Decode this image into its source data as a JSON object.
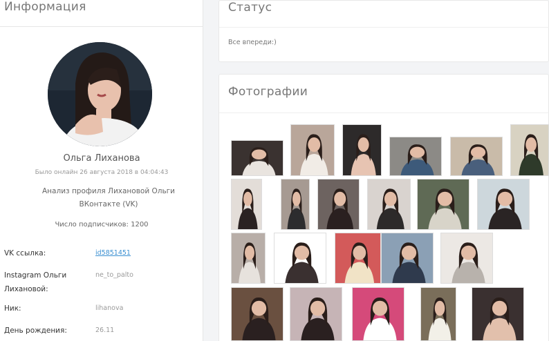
{
  "info_panel": {
    "title": "Информация",
    "name": "Ольга Лиханова",
    "last_seen": "Было онлайн 26 августа 2018 в 04:04:43",
    "analysis": "Анализ профиля Лихановой Ольги ВКонтакте (VK)",
    "subscribers": "Число подписчиков: 1200",
    "rows": [
      {
        "label": "VK ссылка:",
        "value": "id5851451"
      },
      {
        "label": "Instagram Ольги Лихановой:",
        "value": "ne_to_palto"
      },
      {
        "label": "Ник:",
        "value": "lihanova"
      },
      {
        "label": "День рождения:",
        "value": "26.11"
      }
    ]
  },
  "status_panel": {
    "title": "Статус",
    "text": "Все впереди:)"
  },
  "photos_panel": {
    "title": "Фотографии"
  },
  "colors": {
    "link": "#3a8fd1",
    "heading": "#777777",
    "page_background": "#f3f4f6"
  }
}
